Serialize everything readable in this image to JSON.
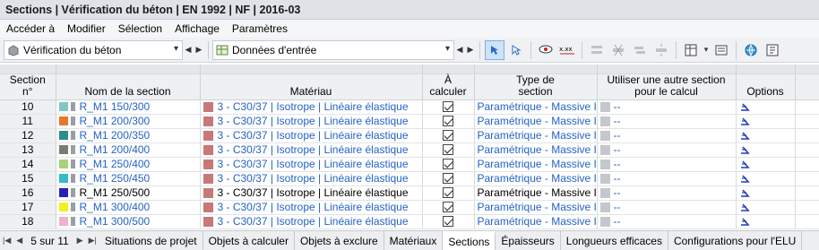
{
  "title": "Sections | Vérification du béton | EN 1992 | NF | 2016-03",
  "menu": [
    "Accéder à",
    "Modifier",
    "Sélection",
    "Affichage",
    "Paramètres"
  ],
  "toolbar": {
    "module": "Vérification du béton",
    "table": "Données d'entrée"
  },
  "columns": {
    "section": "Section\nn°",
    "name": "Nom de la section",
    "material": "Matériau",
    "calc": "À\ncalculer",
    "type": "Type de\nsection",
    "other": "Utiliser une autre section\npour le calcul",
    "options": "Options"
  },
  "rows": [
    {
      "n": "10",
      "name": "R_M1 150/300",
      "color": "#7fc7c4",
      "mat": "3 - C30/37 | Isotrope | Linéaire élastique",
      "type": "Paramétrique - Massive I",
      "other": "--",
      "blue": true
    },
    {
      "n": "11",
      "name": "R_M1 200/300",
      "color": "#e8772a",
      "mat": "3 - C30/37 | Isotrope | Linéaire élastique",
      "type": "Paramétrique - Massive I",
      "other": "--",
      "blue": true
    },
    {
      "n": "12",
      "name": "R_M1 200/350",
      "color": "#2a8f8a",
      "mat": "3 - C30/37 | Isotrope | Linéaire élastique",
      "type": "Paramétrique - Massive I",
      "other": "--",
      "blue": true
    },
    {
      "n": "13",
      "name": "R_M1 200/400",
      "color": "#7a7a7a",
      "mat": "3 - C30/37 | Isotrope | Linéaire élastique",
      "type": "Paramétrique - Massive I",
      "other": "--",
      "blue": true
    },
    {
      "n": "14",
      "name": "R_M1 250/400",
      "color": "#a8d27a",
      "mat": "3 - C30/37 | Isotrope | Linéaire élastique",
      "type": "Paramétrique - Massive I",
      "other": "--",
      "blue": true
    },
    {
      "n": "15",
      "name": "R_M1 250/450",
      "color": "#36b9c9",
      "mat": "3 - C30/37 | Isotrope | Linéaire élastique",
      "type": "Paramétrique - Massive I",
      "other": "--",
      "blue": true
    },
    {
      "n": "16",
      "name": "R_M1 250/500",
      "color": "#2a1fb0",
      "mat": "3 - C30/37 | Isotrope | Linéaire élastique",
      "type": "Paramétrique - Massive I",
      "other": "--",
      "blue": false
    },
    {
      "n": "17",
      "name": "R_M1 300/400",
      "color": "#f0f020",
      "mat": "3 - C30/37 | Isotrope | Linéaire élastique",
      "type": "Paramétrique - Massive I",
      "other": "--",
      "blue": true
    },
    {
      "n": "18",
      "name": "R_M1 300/500",
      "color": "#f0b0d0",
      "mat": "3 - C30/37 | Isotrope | Linéaire élastique",
      "type": "Paramétrique - Massive I",
      "other": "--",
      "blue": true
    }
  ],
  "pager": "5 sur 11",
  "tabs": [
    "Situations de projet",
    "Objets à calculer",
    "Objets à exclure",
    "Matériaux",
    "Sections",
    "Épaisseurs",
    "Longueurs efficaces",
    "Configurations pour l'ELU"
  ],
  "active_tab": "Sections"
}
